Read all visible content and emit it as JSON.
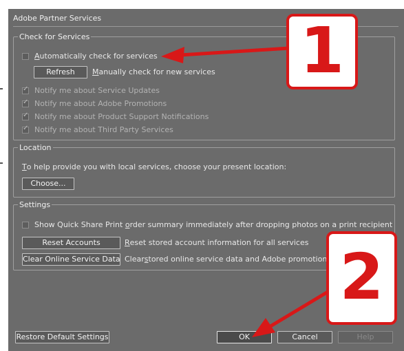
{
  "dialog": {
    "title": "Adobe Partner Services"
  },
  "check_services": {
    "legend": "Check for Services",
    "auto_check": {
      "pre": "",
      "accel": "A",
      "post": "utomatically check for services",
      "checked": false
    },
    "refresh_button": "Refresh",
    "manual": {
      "accel": "M",
      "post": "anually check for new services"
    },
    "notify": [
      {
        "label": "Notify me about Service Updates",
        "checked": true
      },
      {
        "label": "Notify me about Adobe Promotions",
        "checked": true
      },
      {
        "label": "Notify me about Product Support Notifications",
        "checked": true
      },
      {
        "label": "Notify me about Third Party Services",
        "checked": true
      }
    ]
  },
  "location": {
    "legend": "Location",
    "prompt_accel": "T",
    "prompt_post": "o help provide you with local services, choose your present location:",
    "choose_button": "Choose..."
  },
  "settings": {
    "legend": "Settings",
    "quick_share": {
      "pre": "Show Quick Share Print ",
      "accel": "o",
      "post": "rder summary immediately after dropping photos on a print recipient",
      "checked": false
    },
    "reset_button": "Reset Accounts",
    "reset_desc_accel": "R",
    "reset_desc_post": "eset stored account information for all services",
    "clear_button": "Clear Online Service Data",
    "clear_desc_pre": "Clear ",
    "clear_desc_accel": "s",
    "clear_desc_post": "tored online service data and Adobe promotions"
  },
  "footer": {
    "restore_button": "Restore Default Settings",
    "ok_button": "OK",
    "cancel_button": "Cancel",
    "help_button": "Help"
  },
  "callouts": [
    {
      "number": "1"
    },
    {
      "number": "2"
    }
  ],
  "colors": {
    "dialog_bg": "#6b6b6b",
    "callout_red": "#d81818",
    "arrow_red": "#d81818"
  }
}
